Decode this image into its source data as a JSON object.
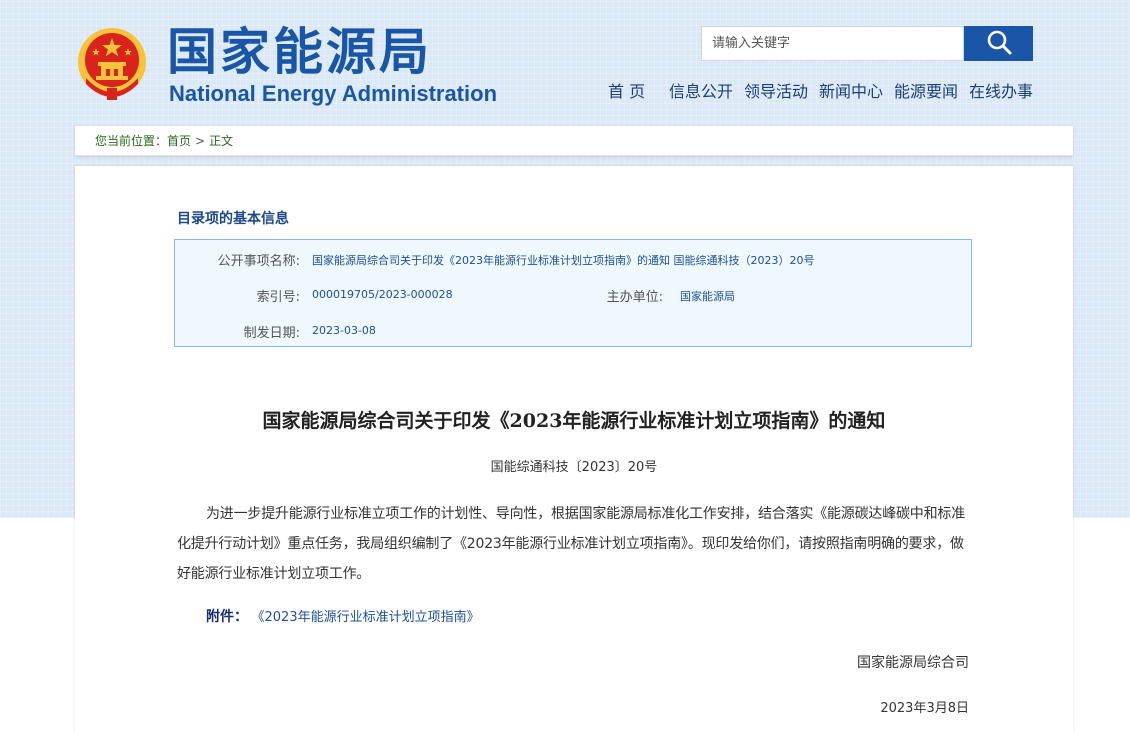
{
  "header": {
    "logo_cn": "国家能源局",
    "logo_en": "National Energy Administration",
    "search_placeholder": "请输入关键字",
    "nav": [
      "首 页",
      "信息公开",
      "领导活动",
      "新闻中心",
      "能源要闻",
      "在线办事"
    ]
  },
  "breadcrumb": {
    "prefix": "您当前位置：",
    "home": "首页",
    "separator": ">",
    "current": "正文"
  },
  "info": {
    "title": "目录项的基本信息",
    "rows": [
      {
        "label": "公开事项名称:",
        "value": "国家能源局综合司关于印发《2023年能源行业标准计划立项指南》的通知 国能综通科技（2023）20号"
      },
      {
        "label": "索引号:",
        "value": "000019705/2023-000028"
      },
      {
        "label": "主办单位:",
        "value": "国家能源局"
      },
      {
        "label": "制发日期:",
        "value": "2023-03-08"
      }
    ]
  },
  "document": {
    "title": "国家能源局综合司关于印发《2023年能源行业标准计划立项指南》的通知",
    "number": "国能综通科技〔2023〕20号",
    "body": "为进一步提升能源行业标准立项工作的计划性、导向性，根据国家能源局标准化工作安排，结合落实《能源碳达峰碳中和标准化提升行动计划》重点任务，我局组织编制了《2023年能源行业标准计划立项指南》。现印发给你们，请按照指南明确的要求，做好能源行业标准计划立项工作。",
    "attachment_label": "附件：",
    "attachment_link": "《2023年能源行业标准计划立项指南》",
    "signatory": "国家能源局综合司",
    "date": "2023年3月8日"
  },
  "colors": {
    "brand_blue": "#1a56a8",
    "link_blue": "#1d4f9c",
    "breadcrumb_green": "#2a6a1e",
    "info_bg": "#eef8fd",
    "emblem_red": "#d8241c",
    "emblem_gold": "#f6c33a"
  },
  "icons": {
    "emblem": "national-emblem-icon",
    "search": "search-icon"
  }
}
